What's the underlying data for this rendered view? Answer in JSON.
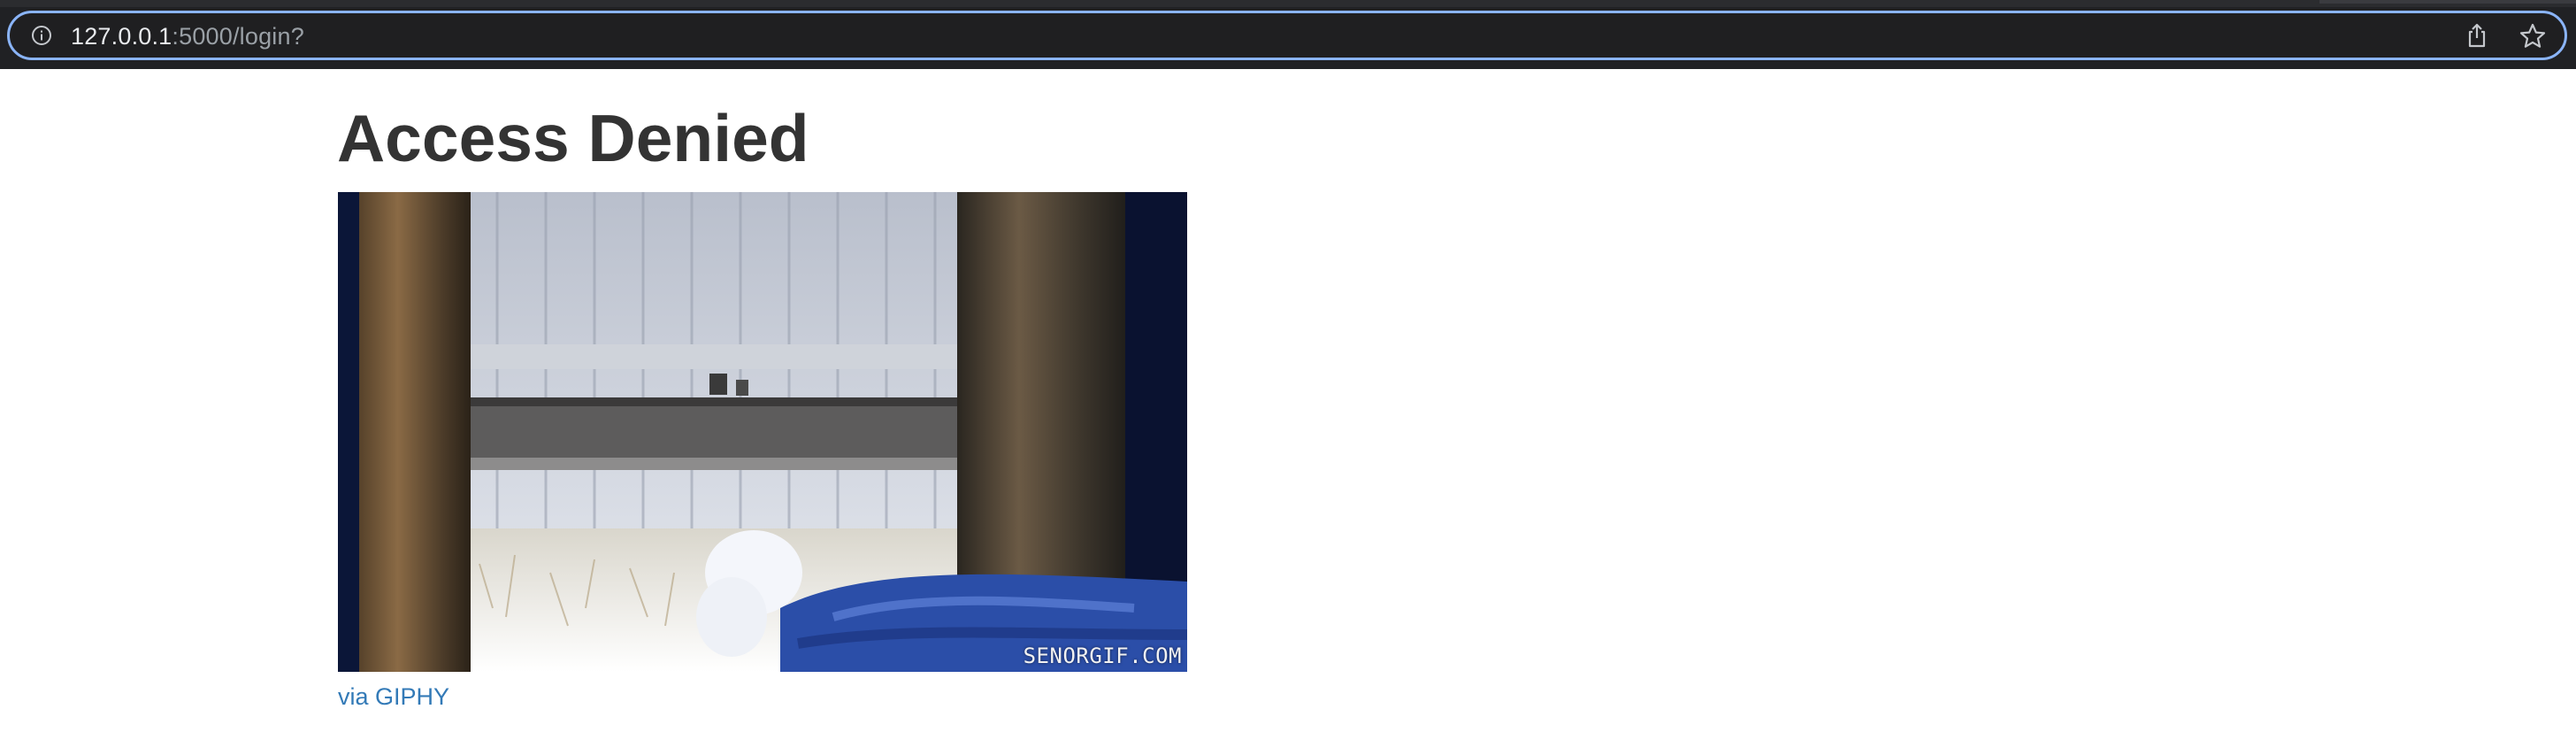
{
  "browser": {
    "url_host": "127.0.0.1",
    "url_rest": ":5000/login?",
    "info_icon": "info-icon",
    "share_icon": "share-icon",
    "bookmark_icon": "star-icon",
    "accent_color": "#8ab4f8"
  },
  "page": {
    "title": "Access Denied",
    "image": {
      "subject": "animated gif",
      "watermark": "SENORGIF.COM"
    },
    "credit_link": "via GIPHY",
    "link_color": "#337ab7",
    "text_color": "#333333"
  }
}
